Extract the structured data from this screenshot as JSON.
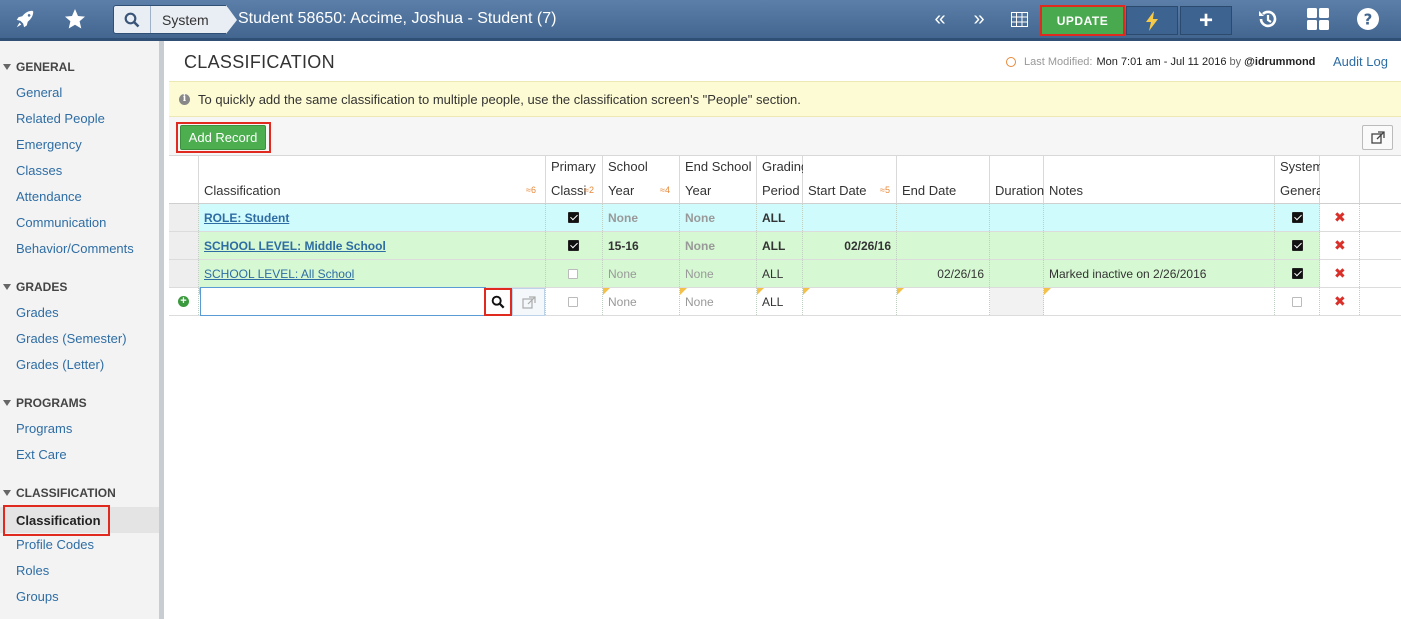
{
  "topbar": {
    "search_label": "System",
    "title": "Student 58650: Accime, Joshua - Student (7)",
    "prev_glyph": "«",
    "next_glyph": "»",
    "update_label": "UPDATE",
    "plus_glyph": "+",
    "icons": [
      "rocket-icon",
      "star-icon",
      "search-icon",
      "grid-icon",
      "bolt-icon",
      "history-icon",
      "dashboard-icon",
      "help-icon"
    ],
    "accent": "#49a94e"
  },
  "sidebar": {
    "sections": [
      {
        "label": "GENERAL",
        "items": [
          "General",
          "Related People",
          "Emergency",
          "Classes",
          "Attendance",
          "Communication",
          "Behavior/Comments"
        ]
      },
      {
        "label": "GRADES",
        "items": [
          "Grades",
          "Grades (Semester)",
          "Grades (Letter)"
        ]
      },
      {
        "label": "PROGRAMS",
        "items": [
          "Programs",
          "Ext Care"
        ]
      },
      {
        "label": "CLASSIFICATION",
        "items": [
          "Classification",
          "Profile Codes",
          "Roles",
          "Groups"
        ]
      }
    ],
    "active": "Classification"
  },
  "page": {
    "title": "CLASSIFICATION",
    "last_modified_label": "Last Modified:",
    "last_modified_value": "Mon 7:01 am - Jul 11 2016",
    "by_label": "by",
    "modified_by": "@idrummond",
    "audit_log": "Audit Log"
  },
  "info": {
    "icon": "info-icon",
    "text": "To quickly add the same classification to multiple people, use the classification screen's \"People\" section."
  },
  "toolbar": {
    "add_record": "Add Record"
  },
  "grid": {
    "headers": {
      "classification": {
        "l1": "",
        "l2": "Classification",
        "sort": "≈6"
      },
      "primary": {
        "l1": "Primary",
        "l2": "Classi",
        "sort": "≈2"
      },
      "school_year": {
        "l1": "School",
        "l2": "Year",
        "sort": "≈4"
      },
      "end_school": {
        "l1": "End School",
        "l2": "Year",
        "sort": ""
      },
      "grading": {
        "l1": "Grading",
        "l2": "Period",
        "sort": ""
      },
      "start_date": {
        "l1": "",
        "l2": "Start Date",
        "sort": "≈5"
      },
      "end_date": {
        "l1": "",
        "l2": "End Date",
        "sort": ""
      },
      "duration": {
        "l1": "",
        "l2": "Duration",
        "sort": ""
      },
      "notes": {
        "l1": "",
        "l2": "Notes",
        "sort": ""
      },
      "system": {
        "l1": "System",
        "l2": "Genera",
        "sort": ""
      }
    },
    "rows": [
      {
        "classification": "ROLE: Student",
        "primary": true,
        "school_year": "None",
        "end_school": "None",
        "grading": "ALL",
        "start_date": "",
        "end_date": "",
        "duration": "",
        "notes": "",
        "system": true
      },
      {
        "classification": "SCHOOL LEVEL: Middle School",
        "primary": true,
        "school_year": "15-16",
        "end_school": "None",
        "grading": "ALL",
        "start_date": "02/26/16",
        "end_date": "",
        "duration": "",
        "notes": "",
        "system": true
      },
      {
        "classification": "SCHOOL LEVEL: All School",
        "primary": false,
        "school_year": "None",
        "end_school": "None",
        "grading": "ALL",
        "start_date": "",
        "end_date": "02/26/16",
        "duration": "",
        "notes": "Marked inactive on 2/26/2016",
        "system": true
      }
    ],
    "new_row": {
      "school_year": "None",
      "end_school": "None",
      "grading": "ALL"
    }
  }
}
